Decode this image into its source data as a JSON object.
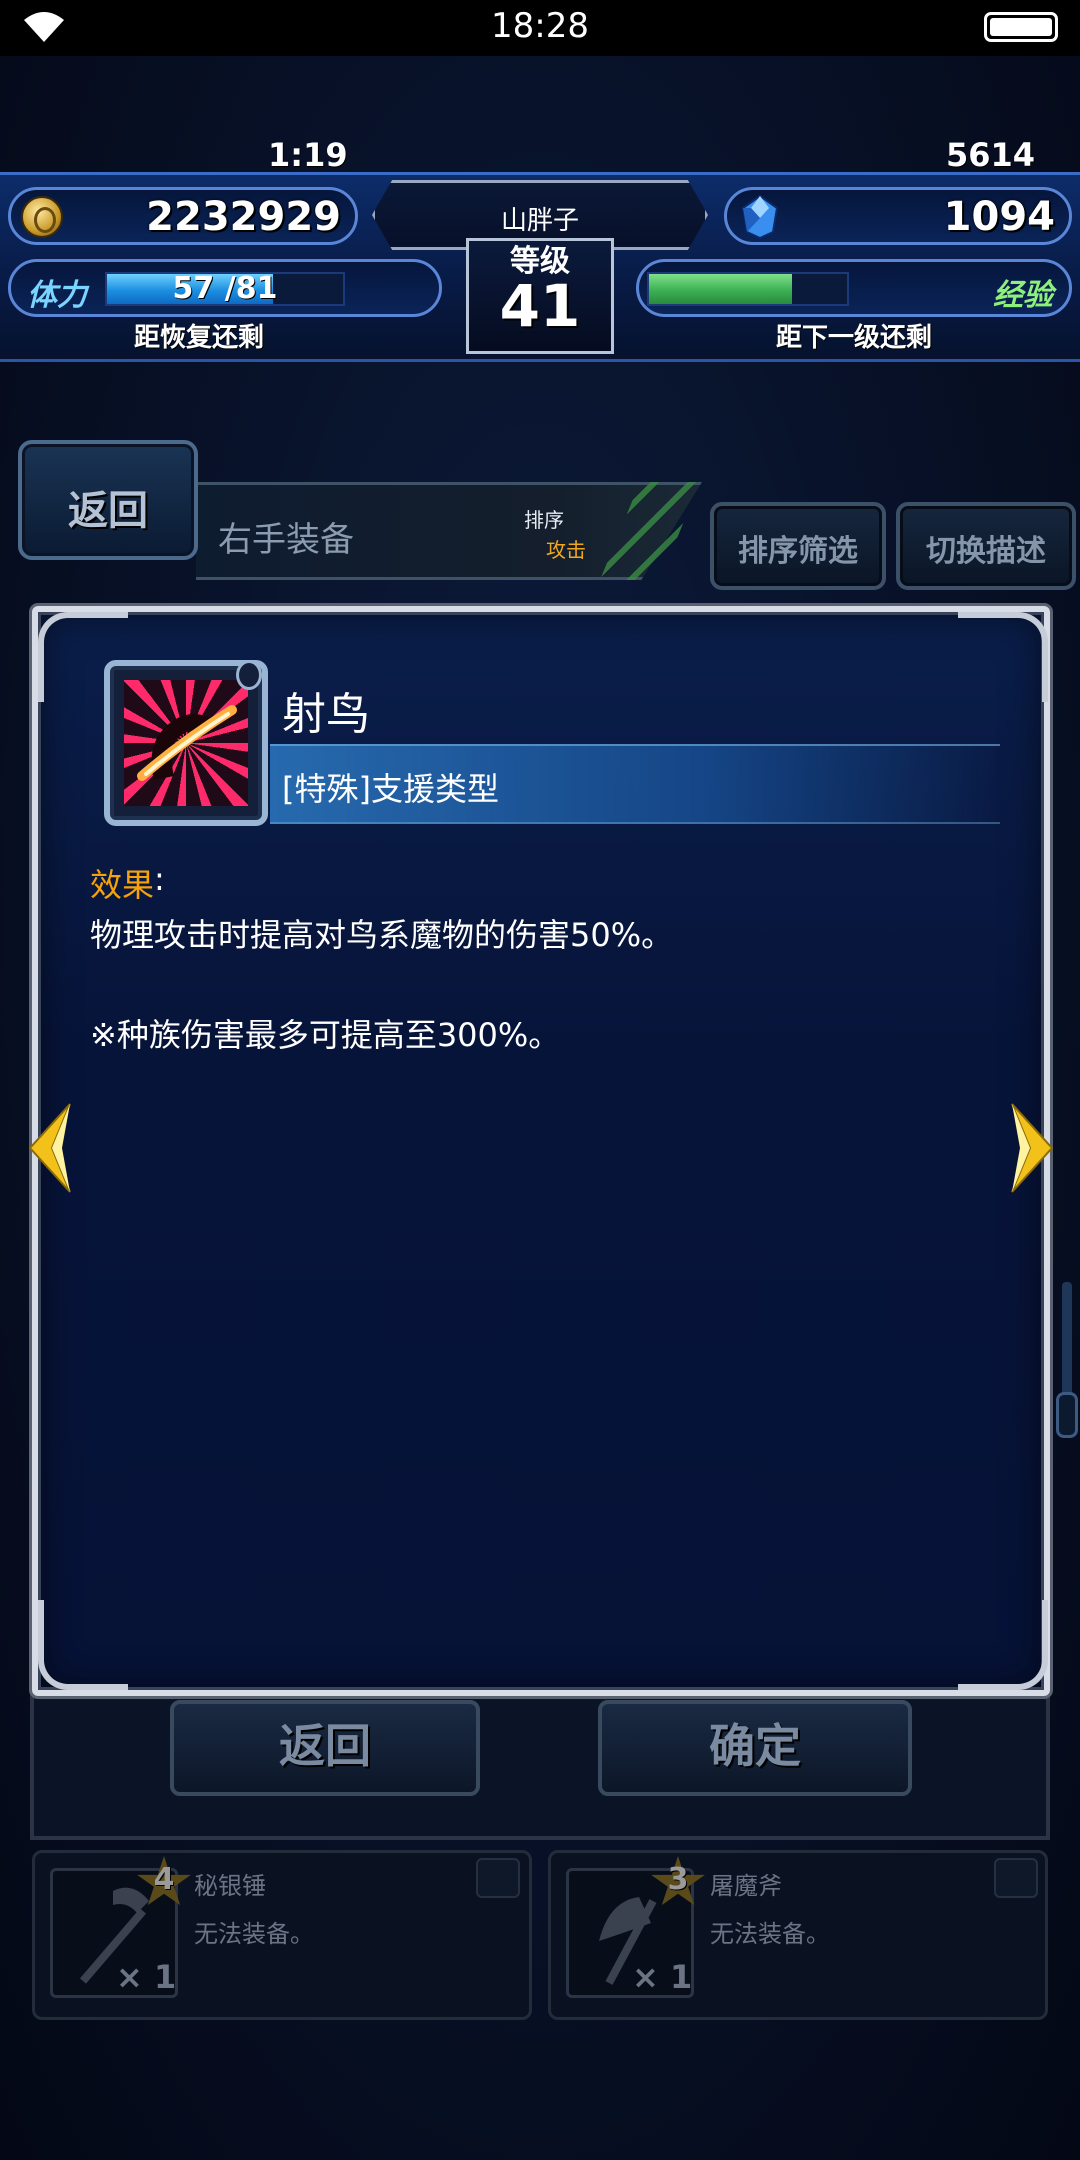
{
  "status_bar": {
    "time": "18:28",
    "wifi_icon": "wifi-icon",
    "battery_icon": "battery-icon"
  },
  "hud": {
    "gil": "2232929",
    "gems": "1094",
    "player_name": "山胖子",
    "level_label": "等级",
    "level": "41",
    "stamina_label": "体力",
    "stamina_value": "57 /81",
    "stamina_fraction": 0.704,
    "recover_label": "距恢复还剩",
    "recover_time": "1:19",
    "exp_label": "经验",
    "exp_fraction": 0.72,
    "next_level_label": "距下一级还剩",
    "next_level_value": "5614"
  },
  "nav": {
    "back": "返回",
    "category": "右手装备",
    "sort_label": "排序",
    "sort_value": "攻击",
    "filter_button": "排序筛选",
    "toggle_desc_button": "切换描述"
  },
  "ability": {
    "name": "射鸟",
    "type": "[特殊]支援类型",
    "effect_label": "效果",
    "effect_colon": ":",
    "effect_line1": "物理攻击时提高对鸟系魔物的伤害50%。",
    "effect_line2": "※种族伤害最多可提高至300%。"
  },
  "underlying_dialog": {
    "back": "返回",
    "confirm": "确定"
  },
  "items": [
    {
      "name": "秘银锤",
      "rarity": "4",
      "status": "无法装备。",
      "qty": "× 1",
      "icon": "hammer-icon"
    },
    {
      "name": "屠魔斧",
      "rarity": "3",
      "status": "无法装备。",
      "qty": "× 1",
      "icon": "axe-icon"
    }
  ],
  "colors": {
    "accent_orange": "#f6a20a",
    "stamina_blue": "#1c8fe0",
    "exp_green": "#3cb054",
    "dialog_bg": "#07143a"
  }
}
